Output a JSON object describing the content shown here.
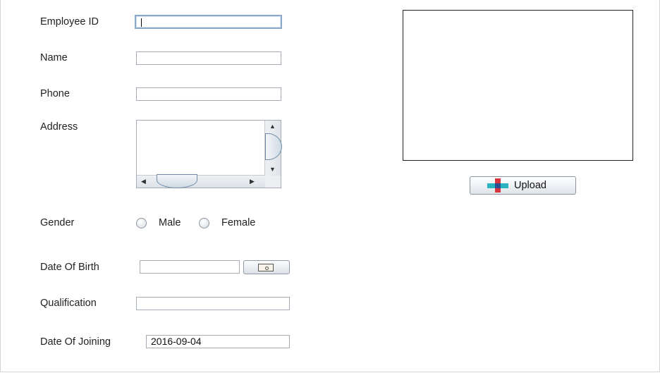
{
  "form": {
    "employee_id": {
      "label": "Employee ID",
      "value": "I"
    },
    "name": {
      "label": "Name",
      "value": ""
    },
    "phone": {
      "label": "Phone",
      "value": ""
    },
    "address": {
      "label": "Address",
      "value": ""
    },
    "gender": {
      "label": "Gender",
      "options": [
        "Male",
        "Female"
      ]
    },
    "date_of_birth": {
      "label": "Date Of Birth",
      "value": ""
    },
    "qualification": {
      "label": "Qualification",
      "value": ""
    },
    "date_of_joining": {
      "label": "Date Of Joining",
      "value": "2016-09-04"
    }
  },
  "photo": {
    "upload_label": "Upload"
  },
  "icons": {
    "upload": "plus-icon",
    "calendar": "calendar-icon",
    "scroll_up": "arrow-up-icon",
    "scroll_down": "arrow-down-icon",
    "scroll_left": "arrow-left-icon",
    "scroll_right": "arrow-right-icon"
  },
  "colors": {
    "field_border": "#a5acb5",
    "focus_border": "#8aa8c8",
    "upload_plus_h": "#2bb3c0",
    "upload_plus_v": "#d8343b"
  }
}
